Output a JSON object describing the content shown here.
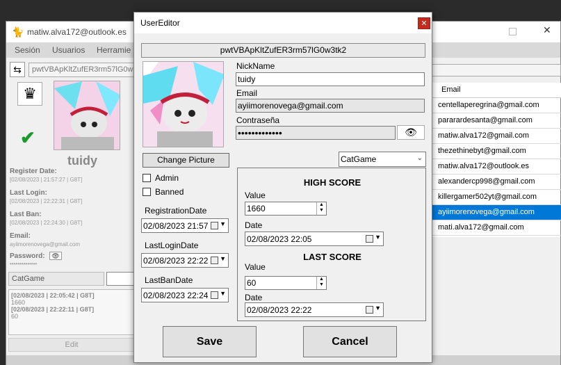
{
  "main_window": {
    "title": "matiw.alva172@outlook.es",
    "menu": [
      "Sesión",
      "Usuarios",
      "Herramie"
    ],
    "search_value": "pwtVBApKltZufER3rm57lG0w",
    "selected_nick": "tuidy",
    "details": [
      {
        "label": "Register Date:",
        "value": "[02/08/2023 | 21:57:27 | G8T]"
      },
      {
        "label": "Last Login:",
        "value": "[02/08/2023 | 22:22:31 | G8T]"
      },
      {
        "label": "Last Ban:",
        "value": "[02/08/2023 | 22:24:30 | G8T]"
      },
      {
        "label": "Email:",
        "value": "ayiimorenovega@gmail.com"
      }
    ],
    "password_label": "Password:",
    "password_mask": "••••••••••••••",
    "game_combo": "CatGame",
    "log_lines": [
      "[02/08/2023 | 22:05:42 | G8T]",
      "1660",
      "[02/08/2023 | 22:22:11 | G8T]",
      "60"
    ],
    "edit_label": "Edit",
    "grid": {
      "header": "Email",
      "rows": [
        "centellaperegrina@gmail.com",
        "pararardesanta@gmail.com",
        "matiw.alva172@gmail.com",
        "thezethinebyt@gmail.com",
        "matiw.alva172@outlook.es",
        "alexandercp998@gmail.com",
        "killergamer502yt@gmail.com",
        "ayiimorenovega@gmail.com",
        "mati.alva172@gmail.com"
      ],
      "selected_index": 7
    }
  },
  "dialog": {
    "title": "UserEditor",
    "user_id": "pwtVBApKltZufER3rm57lG0w3tk2",
    "change_picture_label": "Change Picture",
    "admin_label": "Admin",
    "banned_label": "Banned",
    "registration_label": "RegistrationDate",
    "registration_value": "02/08/2023 21:57",
    "lastlogin_label": "LastLoginDate",
    "lastlogin_value": "02/08/2023 22:22",
    "lastban_label": "LastBanDate",
    "lastban_value": "02/08/2023 22:24",
    "nick_label": "NickName",
    "nick_value": "tuidy",
    "email_label": "Email",
    "email_value": "ayiimorenovega@gmail.com",
    "password_label": "Contraseña",
    "password_mask": "•••••••••••••",
    "game_value": "CatGame",
    "high_score": {
      "title": "HIGH SCORE",
      "value_label": "Value",
      "value": "1660",
      "date_label": "Date",
      "date": "02/08/2023 22:05"
    },
    "last_score": {
      "title": "LAST SCORE",
      "value_label": "Value",
      "value": "60",
      "date_label": "Date",
      "date": "02/08/2023 22:22"
    },
    "save_label": "Save",
    "cancel_label": "Cancel"
  },
  "colors": {
    "accent": "#0078d7",
    "close_red": "#c42b1c",
    "check_green": "#1a9a2a"
  }
}
